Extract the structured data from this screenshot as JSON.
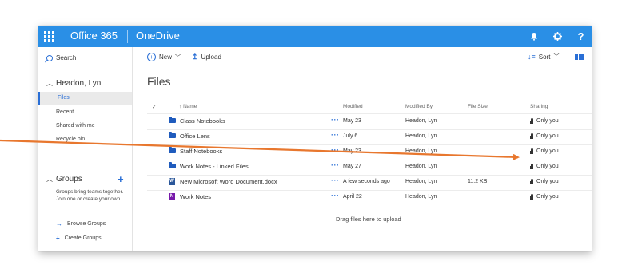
{
  "topbar": {
    "brand": "Office 365",
    "app": "OneDrive",
    "bell_icon": "bell-icon",
    "gear_icon": "gear-icon",
    "help_label": "?",
    "color": "#2a8fe6"
  },
  "sidebar": {
    "search_label": "Search",
    "owner": "Headon, Lyn",
    "items": [
      {
        "label": "Files",
        "selected": true
      },
      {
        "label": "Recent"
      },
      {
        "label": "Shared with me"
      },
      {
        "label": "Recycle bin"
      }
    ],
    "groups_title": "Groups",
    "groups_desc": "Groups bring teams together. Join one or create your own.",
    "browse_groups": "Browse Groups",
    "create_groups": "Create Groups"
  },
  "commandbar": {
    "new_label": "New",
    "upload_label": "Upload",
    "sort_label": "Sort"
  },
  "main": {
    "title": "Files",
    "columns": {
      "name": "Name",
      "modified": "Modified",
      "modified_by": "Modified By",
      "file_size": "File Size",
      "sharing": "Sharing"
    },
    "rows": [
      {
        "type": "folder",
        "name": "Class Notebooks",
        "modified": "May 23",
        "by": "Headon, Lyn",
        "size": "",
        "sharing": "Only you"
      },
      {
        "type": "folder",
        "name": "Office Lens",
        "modified": "July 6",
        "by": "Headon, Lyn",
        "size": "",
        "sharing": "Only you"
      },
      {
        "type": "folder",
        "name": "Staff Notebooks",
        "modified": "May 23",
        "by": "Headon, Lyn",
        "size": "",
        "sharing": "Only you"
      },
      {
        "type": "folder",
        "name": "Work Notes - Linked Files",
        "modified": "May 27",
        "by": "Headon, Lyn",
        "size": "",
        "sharing": "Only you"
      },
      {
        "type": "word",
        "name": "New Microsoft Word Document.docx",
        "modified": "A few seconds ago",
        "by": "Headon, Lyn",
        "size": "11.2 KB",
        "sharing": "Only you"
      },
      {
        "type": "onenote",
        "name": "Work Notes",
        "modified": "April 22",
        "by": "Headon, Lyn",
        "size": "",
        "sharing": "Only you"
      }
    ],
    "drag_hint": "Drag files here to upload"
  },
  "annotation": {
    "color": "#e8772e"
  }
}
